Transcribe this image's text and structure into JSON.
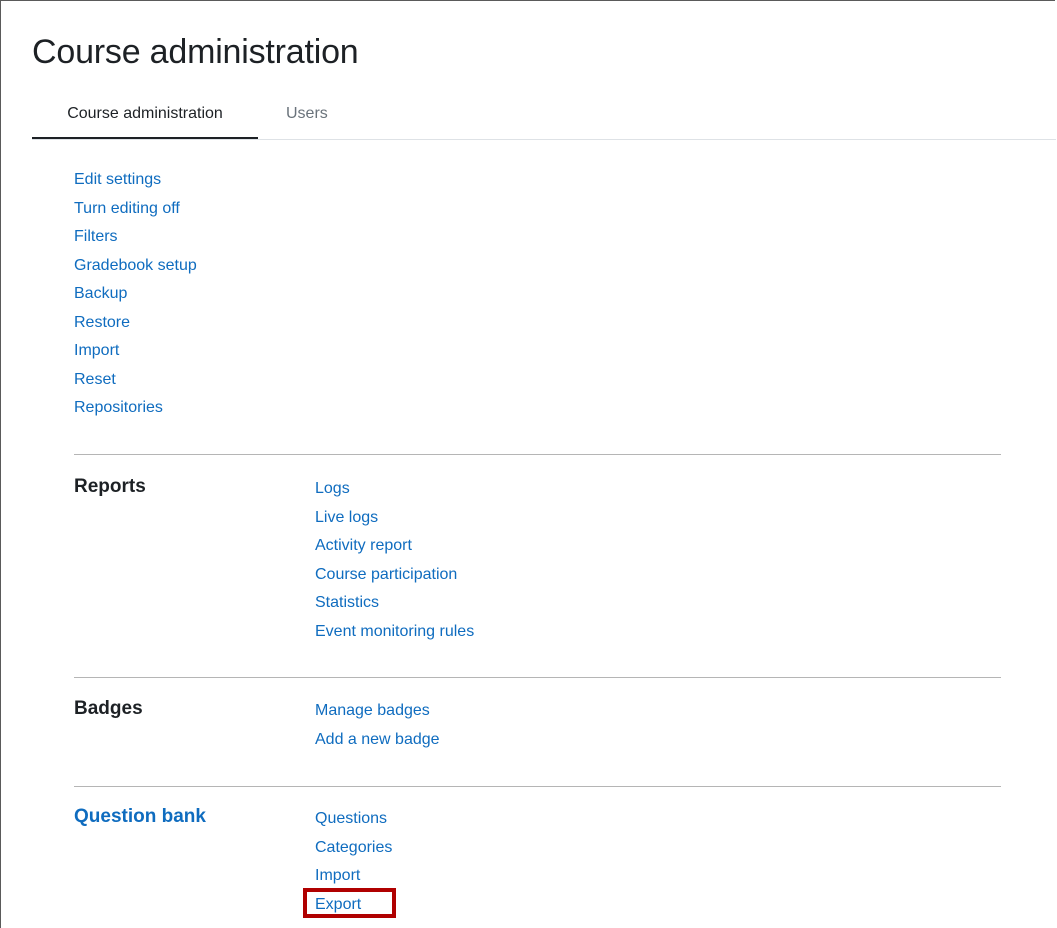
{
  "page": {
    "title": "Course administration"
  },
  "tabs": [
    {
      "label": "Course administration",
      "active": true
    },
    {
      "label": "Users",
      "active": false
    }
  ],
  "admin_links": [
    "Edit settings",
    "Turn editing off",
    "Filters",
    "Gradebook setup",
    "Backup",
    "Restore",
    "Import",
    "Reset",
    "Repositories"
  ],
  "sections": {
    "reports": {
      "heading": "Reports",
      "links": [
        "Logs",
        "Live logs",
        "Activity report",
        "Course participation",
        "Statistics",
        "Event monitoring rules"
      ]
    },
    "badges": {
      "heading": "Badges",
      "links": [
        "Manage badges",
        "Add a new badge"
      ]
    },
    "question_bank": {
      "heading": "Question bank",
      "links": [
        "Questions",
        "Categories",
        "Import",
        "Export"
      ]
    }
  },
  "colors": {
    "link": "#0f6cbf",
    "text": "#1d2125",
    "muted": "#6a737b",
    "highlight": "#b00000"
  }
}
